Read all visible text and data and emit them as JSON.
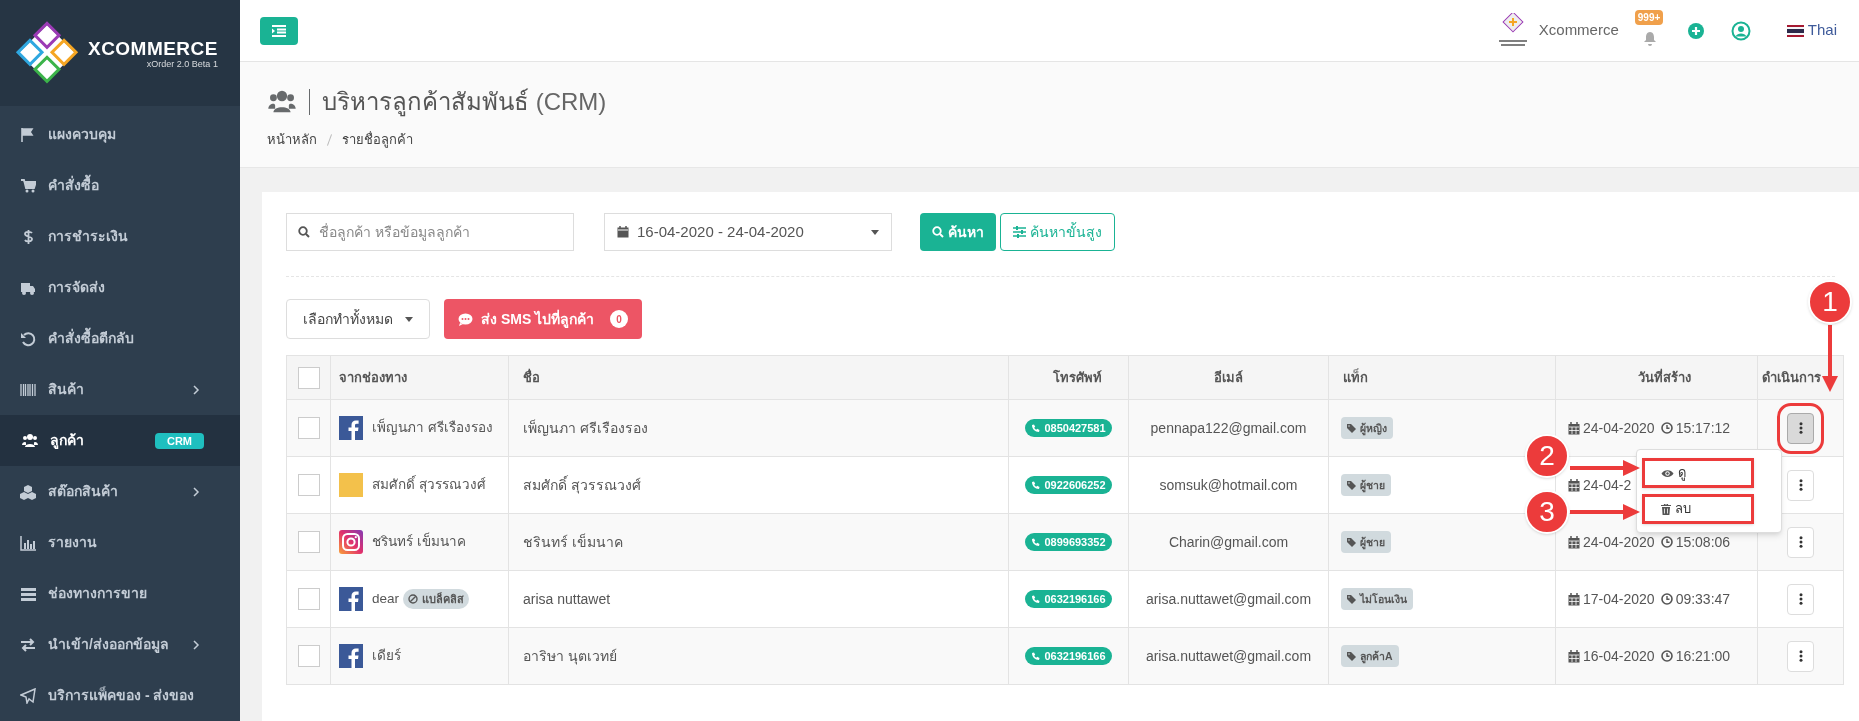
{
  "sidebar": {
    "logo": {
      "title": "XCOMMERCE",
      "subtitle": "xOrder 2.0 Beta 1"
    },
    "items": [
      {
        "label": "แผงควบคุม",
        "selected": false,
        "expandable": false
      },
      {
        "label": "คำสั่งซื้อ",
        "selected": false,
        "expandable": false
      },
      {
        "label": "การชำระเงิน",
        "selected": false,
        "expandable": false
      },
      {
        "label": "การจัดส่ง",
        "selected": false,
        "expandable": false
      },
      {
        "label": "คำสั่งซื้อตีกลับ",
        "selected": false,
        "expandable": false
      },
      {
        "label": "สินค้า",
        "selected": false,
        "expandable": true
      },
      {
        "label": "ลูกค้า",
        "selected": true,
        "expandable": false,
        "badge": "CRM"
      },
      {
        "label": "สต๊อกสินค้า",
        "selected": false,
        "expandable": true
      },
      {
        "label": "รายงาน",
        "selected": false,
        "expandable": false
      },
      {
        "label": "ช่องทางการขาย",
        "selected": false,
        "expandable": false
      },
      {
        "label": "นำเข้า/ส่งออกข้อมูล",
        "selected": false,
        "expandable": true
      },
      {
        "label": "บริการแพ็คของ - ส่งของ",
        "selected": false,
        "expandable": false
      }
    ]
  },
  "topbar": {
    "brand": "Xcommerce",
    "notification_count": "999+",
    "language": "Thai"
  },
  "page": {
    "title": "บริหารลูกค้าสัมพันธ์",
    "title_suffix": "(CRM)",
    "breadcrumb": [
      "หน้าหลัก",
      "รายชื่อลูกค้า"
    ]
  },
  "filters": {
    "search_placeholder": "ชื่อลูกค้า หรือข้อมูลลูกค้า",
    "date_range": "16-04-2020 - 24-04-2020",
    "search_button": "ค้นหา",
    "advanced_button": "ค้นหาขั้นสูง"
  },
  "actions": {
    "bulk": "เลือกทำทั้งหมด",
    "sms": "ส่ง SMS ไปที่ลูกค้า",
    "sms_count": "0"
  },
  "table": {
    "select_all_checked": false,
    "columns": [
      "จากช่องทาง",
      "ชื่อ",
      "โทรศัพท์",
      "อีเมล์",
      "แท็ก",
      "วันที่สร้าง",
      "ดำเนินการ"
    ],
    "rows": [
      {
        "checked": false,
        "kind": "facebook",
        "channel_name": "เพ็ญนภา ศรีเรืองรอง",
        "name": "เพ็ญนภา ศรีเรืองรอง",
        "phone": "0850427581",
        "email": "pennapa122@gmail.com",
        "tag": "ผู้หญิง",
        "date": "24-04-2020",
        "time": "15:17:12",
        "menu_open": true,
        "menu": [
          "ดู",
          "ลบ"
        ]
      },
      {
        "checked": false,
        "kind": "photo",
        "channel_name": "สมศักดิ์ สุวรรณวงศ์",
        "name": "สมศักดิ์ สุวรรณวงศ์",
        "phone": "0922606252",
        "email": "somsuk@hotmail.com",
        "tag": "ผู้ชาย",
        "date": "24-04-2",
        "menu_open": false
      },
      {
        "checked": false,
        "kind": "instagram",
        "channel_name": "ชรินทร์ เข็มนาค",
        "name": "ชรินทร์ เข็มนาค",
        "phone": "0899693352",
        "email": "Charin@gmail.com",
        "tag": "ผู้ชาย",
        "date": "24-04-2020",
        "time": "15:08:06",
        "menu_open": false
      },
      {
        "checked": false,
        "kind": "facebook",
        "channel_name": "dear",
        "blacklist": "แบล็คลิส",
        "name": "arisa nuttawet",
        "phone": "0632196166",
        "email": "arisa.nuttawet@gmail.com",
        "tag": "ไม่โอนเงิน",
        "date": "17-04-2020",
        "time": "09:33:47",
        "menu_open": false
      },
      {
        "checked": false,
        "kind": "facebook",
        "channel_name": "เดียร์",
        "name": "อาริษา นุตเวทย์",
        "phone": "0632196166",
        "email": "arisa.nuttawet@gmail.com",
        "tag": "ลูกค้าA",
        "date": "16-04-2020",
        "time": "16:21:00",
        "menu_open": false
      }
    ]
  },
  "annotations": [
    "1",
    "2",
    "3"
  ]
}
